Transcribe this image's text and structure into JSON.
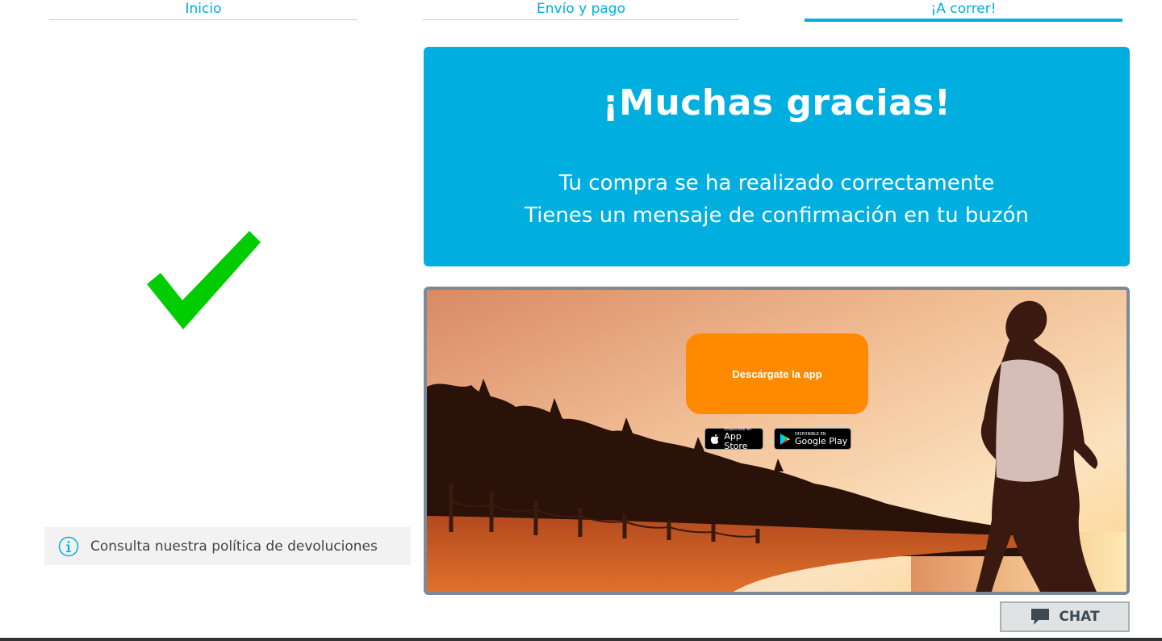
{
  "colors": {
    "accent": "#00aee0",
    "check": "#00cc00",
    "button": "#ff8a00",
    "step_line": "#c8c8c8"
  },
  "steps": [
    {
      "label": "Inicio",
      "active": false
    },
    {
      "label": "Envío y pago",
      "active": false
    },
    {
      "label": "¡A correr!",
      "active": true
    }
  ],
  "thanks": {
    "title": "¡Muchas gracias!",
    "line1": "Tu compra se ha realizado correctamente",
    "line2": "Tienes un mensaje de confirmación en tu buzón"
  },
  "policy": {
    "icon": "info-icon",
    "text": "Consulta nuestra política de devoluciones"
  },
  "app": {
    "button_label": "Descárgate la app",
    "appstore": {
      "small": "Disponible en",
      "big": "App Store",
      "icon": "apple-icon"
    },
    "googleplay": {
      "small": "DISPONIBLE EN",
      "big": "Google Play",
      "icon": "play-icon"
    }
  },
  "chat": {
    "label": "CHAT",
    "icon": "chat-bubble-icon"
  }
}
